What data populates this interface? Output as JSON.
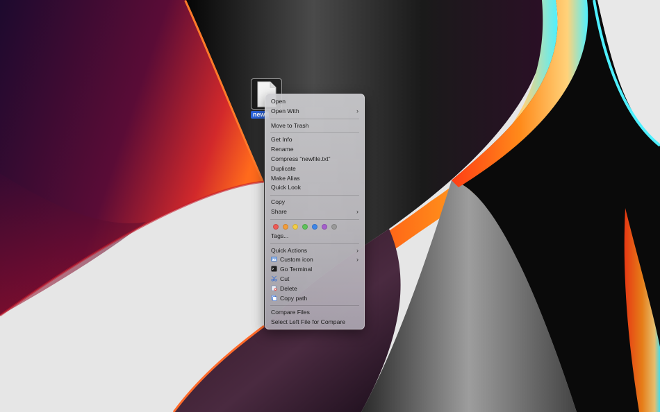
{
  "desktop": {
    "file_label": "newfile.txt"
  },
  "menu": {
    "open": "Open",
    "open_with": "Open With",
    "move_to_trash": "Move to Trash",
    "get_info": "Get Info",
    "rename": "Rename",
    "compress": "Compress “newfile.txt”",
    "duplicate": "Duplicate",
    "make_alias": "Make Alias",
    "quick_look": "Quick Look",
    "copy": "Copy",
    "share": "Share",
    "tags": "Tags...",
    "quick_actions": "Quick Actions",
    "custom_icon": "Custom icon",
    "go_terminal": "Go Terminal",
    "cut": "Cut",
    "delete": "Delete",
    "copy_path": "Copy path",
    "compare_files": "Compare Files",
    "select_left": "Select Left File for Compare",
    "chevron": "›"
  },
  "tag_colors": {
    "red": "#ee5b56",
    "orange": "#f29d3b",
    "yellow": "#f3cd47",
    "green": "#5fc35b",
    "blue": "#3f86e8",
    "purple": "#a55fcc",
    "gray": "#9a9a9a"
  }
}
